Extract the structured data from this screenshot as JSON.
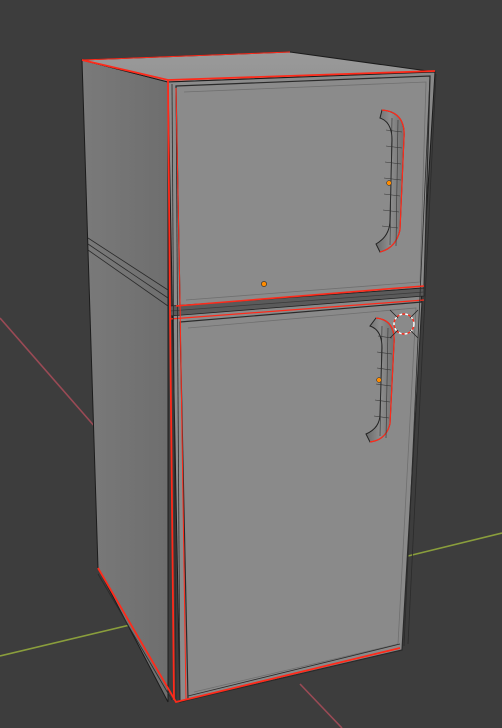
{
  "viewport": {
    "background_color": "#3d3d3d",
    "grid_axis_x_color": "#8a9e3c",
    "grid_axis_y_color": "#9a4a55",
    "selection_outline_color": "#ff2a1a",
    "object_origin_color": "#ff8c00",
    "cursor_3d_color": "#ffffff",
    "cursor_3d_accent": "#ff2a1a"
  },
  "object": {
    "type": "mesh",
    "description": "refrigerator",
    "selected": true,
    "shading": "solid",
    "wireframe_overlay": true
  }
}
